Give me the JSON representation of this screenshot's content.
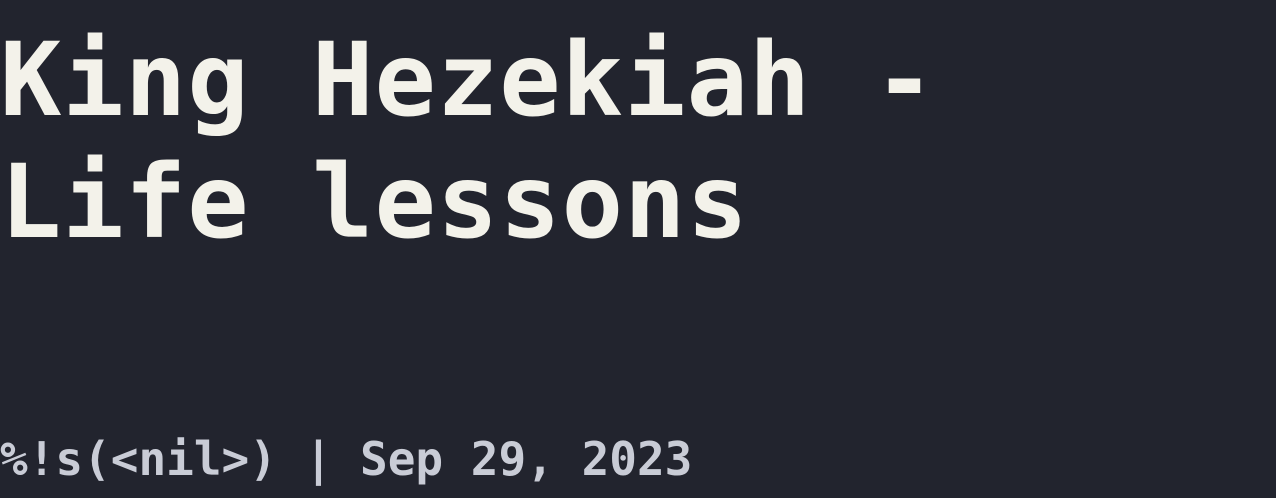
{
  "post": {
    "title_line_1": "King Hezekiah -",
    "title_line_2": "Life lessons",
    "meta": "%!s(<nil>) | Sep 29, 2023"
  },
  "colors": {
    "background": "#22242e",
    "title_text": "#f3f2ea",
    "meta_text": "#c9ccd6"
  }
}
